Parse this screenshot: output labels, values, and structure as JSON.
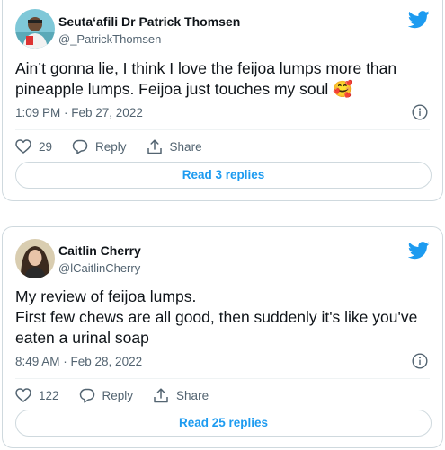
{
  "tweets": [
    {
      "author_name": "Seutaʻafili Dr Patrick Thomsen",
      "author_handle": "@_PatrickThomsen",
      "text": "Ain’t gonna lie, I think I love the feijoa lumps more than pineapple lumps. Feijoa just touches my soul 🥰",
      "timestamp": "1:09 PM · Feb 27, 2022",
      "like_count": "29",
      "reply_label": "Reply",
      "share_label": "Share",
      "read_replies_label": "Read 3 replies"
    },
    {
      "author_name": "Caitlin Cherry",
      "author_handle": "@lCaitlinCherry",
      "text_line1": "My review of feijoa lumps.",
      "text_line2": "First few chews are all good, then suddenly it's like you've eaten a urinal soap",
      "timestamp": "8:49 AM · Feb 28, 2022",
      "like_count": "122",
      "reply_label": "Reply",
      "share_label": "Share",
      "read_replies_label": "Read 25 replies"
    }
  ],
  "colors": {
    "brand": "#1d9bf0",
    "text_primary": "#0f1419",
    "text_secondary": "#536471",
    "border": "#cfd9de"
  },
  "icons": [
    "twitter-bird-icon",
    "info-icon",
    "heart-icon",
    "reply-bubble-icon",
    "share-icon"
  ]
}
